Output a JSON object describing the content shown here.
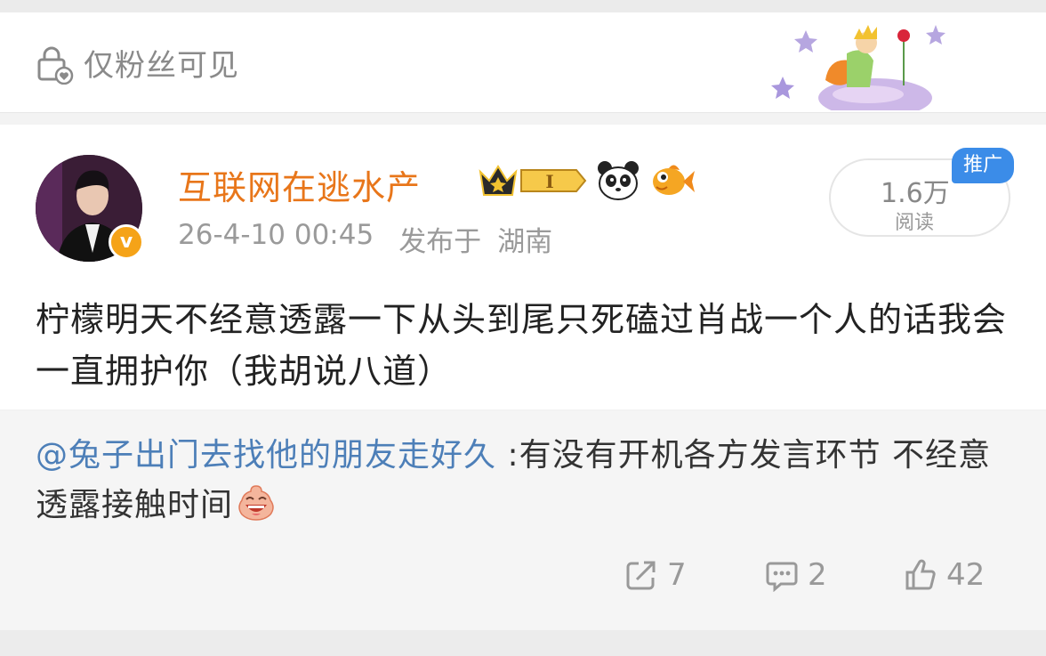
{
  "header": {
    "visibility_text": "仅粉丝可见"
  },
  "post": {
    "username": "互联网在逃水产",
    "level_badge": "I",
    "date": "26-4-10 00:45",
    "published_label": "发布于",
    "location": "湖南",
    "reads_count": "1.6万",
    "reads_label": "阅读",
    "promo_tag": "推广",
    "text": "柠檬明天不经意透露一下从头到尾只死磕过肖战一个人的话我会一直拥护你（我胡说八道）"
  },
  "quoted": {
    "mention": "@兔子出门去找他的朋友走好久",
    "text": " :有没有开机各方发言环节 不经意透露接触时间"
  },
  "actions": {
    "reposts": "7",
    "comments": "2",
    "likes": "42"
  },
  "colors": {
    "username": "#e8761a",
    "mention": "#4d7fb8",
    "promo": "#3b8ce8",
    "verified": "#f5a318"
  }
}
